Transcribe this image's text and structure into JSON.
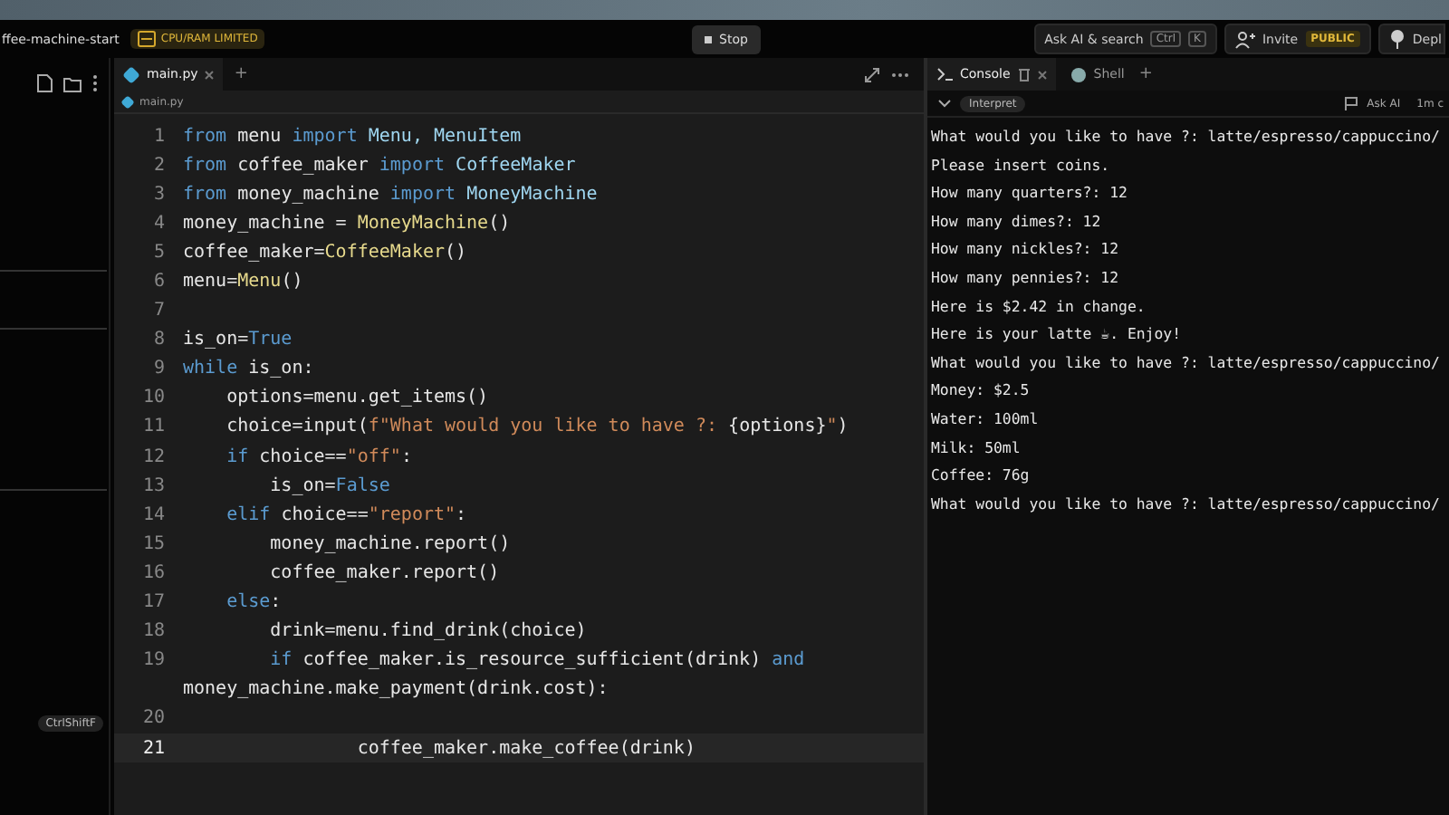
{
  "header": {
    "project": "ffee-machine-start",
    "badge": "CPU/RAM LIMITED",
    "stop": "Stop",
    "search": "Ask AI & search",
    "keys": [
      "Ctrl",
      "K"
    ],
    "invite": "Invite",
    "visibility": "PUBLIC",
    "deploy": "Depl"
  },
  "sidebar": {
    "shortcut": "CtrlShiftF"
  },
  "editor": {
    "tabs": [
      {
        "label": "main.py",
        "selected": true
      }
    ],
    "add": "+",
    "breadcrumb": "main.py",
    "lines": [
      {
        "n": "1",
        "current": false,
        "tokens": [
          {
            "t": "from ",
            "kind": "kw"
          },
          {
            "t": "menu ",
            "kind": "txt"
          },
          {
            "t": "import ",
            "kind": "kw"
          },
          {
            "t": "Menu, MenuItem",
            "kind": "cls"
          }
        ]
      },
      {
        "n": "2",
        "current": false,
        "tokens": [
          {
            "t": "from ",
            "kind": "kw"
          },
          {
            "t": "coffee_maker ",
            "kind": "txt"
          },
          {
            "t": "import ",
            "kind": "kw"
          },
          {
            "t": "CoffeeMaker",
            "kind": "cls"
          }
        ]
      },
      {
        "n": "3",
        "current": false,
        "tokens": [
          {
            "t": "from ",
            "kind": "kw"
          },
          {
            "t": "money_machine ",
            "kind": "txt"
          },
          {
            "t": "import ",
            "kind": "kw"
          },
          {
            "t": "MoneyMachine",
            "kind": "cls"
          }
        ]
      },
      {
        "n": "4",
        "current": false,
        "tokens": [
          {
            "t": "money_machine = ",
            "kind": "txt"
          },
          {
            "t": "MoneyMachine",
            "kind": "fn"
          },
          {
            "t": "()",
            "kind": "txt"
          }
        ]
      },
      {
        "n": "5",
        "current": false,
        "tokens": [
          {
            "t": "coffee_maker=",
            "kind": "txt"
          },
          {
            "t": "CoffeeMaker",
            "kind": "fn"
          },
          {
            "t": "()",
            "kind": "txt"
          }
        ]
      },
      {
        "n": "6",
        "current": false,
        "tokens": [
          {
            "t": "menu=",
            "kind": "txt"
          },
          {
            "t": "Menu",
            "kind": "fn"
          },
          {
            "t": "()",
            "kind": "txt"
          }
        ]
      },
      {
        "n": "7",
        "current": false
      },
      {
        "n": "8",
        "current": false,
        "tokens": [
          {
            "t": "is_on=",
            "kind": "txt"
          },
          {
            "t": "True",
            "kind": "kw"
          }
        ]
      },
      {
        "n": "9",
        "current": false,
        "tokens": [
          {
            "t": "while ",
            "kind": "kw"
          },
          {
            "t": "is_on:",
            "kind": "txt"
          }
        ]
      },
      {
        "n": "10",
        "current": false,
        "tokens": [
          {
            "t": "    options=menu.get_items()",
            "kind": "txt"
          }
        ]
      },
      {
        "n": "11",
        "current": false,
        "tokens": [
          {
            "t": "    choice=input(",
            "kind": "txt"
          },
          {
            "t": "f\"What would you like to have ?: ",
            "kind": "str"
          },
          {
            "t": "{options}",
            "kind": "txt"
          },
          {
            "t": "\"",
            "kind": "str"
          },
          {
            "t": ")",
            "kind": "txt"
          }
        ]
      },
      {
        "n": "12",
        "current": false,
        "tokens": [
          {
            "t": "    if ",
            "kind": "kw"
          },
          {
            "t": "choice==",
            "kind": "txt"
          },
          {
            "t": "\"off\"",
            "kind": "str"
          },
          {
            "t": ":",
            "kind": "txt"
          }
        ]
      },
      {
        "n": "13",
        "current": false,
        "tokens": [
          {
            "t": "        is_on=",
            "kind": "txt"
          },
          {
            "t": "False",
            "kind": "kw"
          }
        ]
      },
      {
        "n": "14",
        "current": false,
        "tokens": [
          {
            "t": "    elif ",
            "kind": "kw"
          },
          {
            "t": "choice==",
            "kind": "txt"
          },
          {
            "t": "\"report\"",
            "kind": "str"
          },
          {
            "t": ":",
            "kind": "txt"
          }
        ]
      },
      {
        "n": "15",
        "current": false,
        "tokens": [
          {
            "t": "        money_machine.report()",
            "kind": "txt"
          }
        ]
      },
      {
        "n": "16",
        "current": false,
        "tokens": [
          {
            "t": "        coffee_maker.report()",
            "kind": "txt"
          }
        ]
      },
      {
        "n": "17",
        "current": false,
        "tokens": [
          {
            "t": "    else",
            "kind": "kw"
          },
          {
            "t": ":",
            "kind": "txt"
          }
        ]
      },
      {
        "n": "18",
        "current": false,
        "tokens": [
          {
            "t": "        drink=menu.find_drink(choice)",
            "kind": "txt"
          }
        ]
      },
      {
        "n": "19",
        "current": false,
        "tokens": [
          {
            "t": "        if ",
            "kind": "kw"
          },
          {
            "t": "coffee_maker.is_resource_sufficient(drink) ",
            "kind": "txt"
          },
          {
            "t": "and",
            "kind": "kw"
          }
        ],
        "wrap": [
          {
            "t": "money_machine.make_payment(drink.cost):",
            "kind": "txt"
          }
        ]
      },
      {
        "n": "20",
        "current": false
      },
      {
        "n": "21",
        "current": true,
        "tokens": [
          {
            "t": "                coffee_maker.make_coffee(drink)",
            "kind": "txt"
          }
        ]
      }
    ]
  },
  "console": {
    "tabs": [
      {
        "label": "Console",
        "selected": true
      },
      {
        "label": "Shell",
        "selected": false
      }
    ],
    "add": "+",
    "interpret": "Interpret",
    "ask": "Ask AI",
    "time": "1m c",
    "output": [
      "What would you like to have ?: latte/espresso/cappuccino/",
      "Please insert coins.",
      "How many quarters?: 12",
      "How many dimes?: 12",
      "How many nickles?: 12",
      "How many pennies?: 12",
      "Here is $2.42 in change.",
      "Here is your latte ☕. Enjoy!",
      "What would you like to have ?: latte/espresso/cappuccino/",
      "Money: $2.5",
      "Water: 100ml",
      "Milk: 50ml",
      "Coffee: 76g",
      "What would you like to have ?: latte/espresso/cappuccino/"
    ]
  }
}
